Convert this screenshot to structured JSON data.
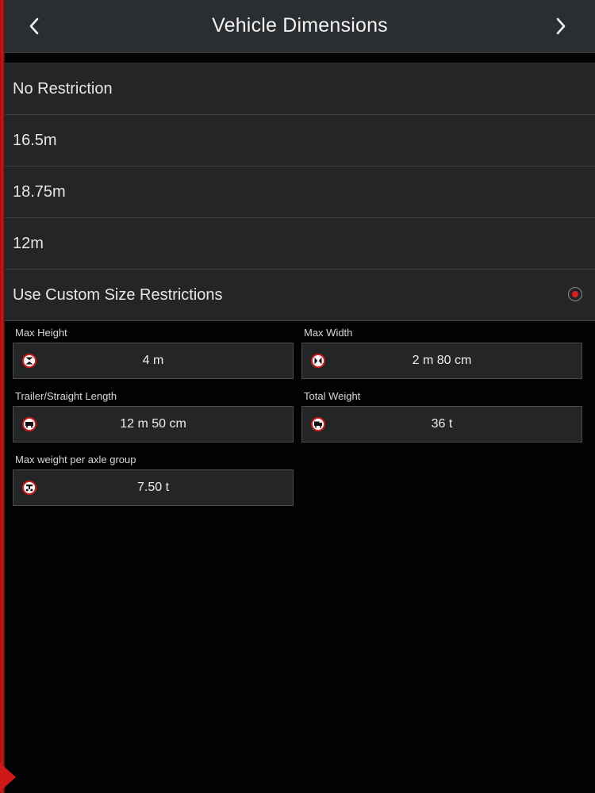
{
  "header": {
    "title": "Vehicle Dimensions",
    "back_icon": "chevron-left-icon",
    "next_icon": "chevron-right-icon"
  },
  "options": [
    {
      "label": "No Restriction",
      "selected": false
    },
    {
      "label": "16.5m",
      "selected": false
    },
    {
      "label": "18.75m",
      "selected": false
    },
    {
      "label": "12m",
      "selected": false
    },
    {
      "label": "Use Custom Size Restrictions",
      "selected": true
    }
  ],
  "fields": {
    "max_height": {
      "label": "Max Height",
      "value": "4 m",
      "icon": "max-height-sign-icon"
    },
    "max_width": {
      "label": "Max Width",
      "value": "2 m 80 cm",
      "icon": "max-width-sign-icon"
    },
    "length": {
      "label": "Trailer/Straight Length",
      "value": "12 m 50 cm",
      "icon": "max-length-sign-icon"
    },
    "total_weight": {
      "label": "Total Weight",
      "value": "36 t",
      "icon": "total-weight-sign-icon"
    },
    "axle_weight": {
      "label": "Max weight per axle group",
      "value": "7.50 t",
      "icon": "axle-weight-sign-icon"
    }
  },
  "colors": {
    "accent": "#e01e1e",
    "header_bg": "#2b2e31",
    "row_bg": "#232527",
    "page_bg": "#020202"
  }
}
